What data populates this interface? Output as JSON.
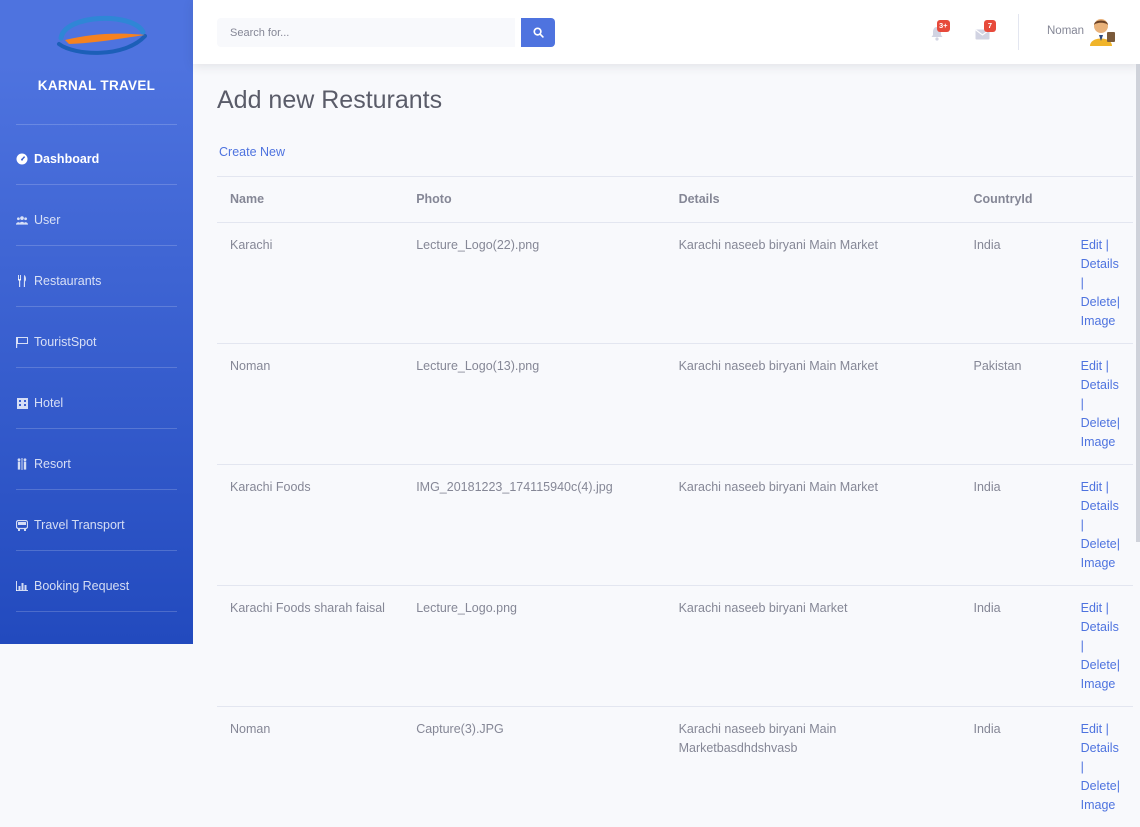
{
  "brand": {
    "name": "KARNAL TRAVEL"
  },
  "sidebar": {
    "items": [
      {
        "label": "Dashboard",
        "icon": "tachometer-icon",
        "active": true
      },
      {
        "label": "User",
        "icon": "users-icon"
      },
      {
        "label": "Restaurants",
        "icon": "utensils-icon"
      },
      {
        "label": "TouristSpot",
        "icon": "flag-icon"
      },
      {
        "label": "Hotel",
        "icon": "building-icon"
      },
      {
        "label": "Resort",
        "icon": "people-icon"
      },
      {
        "label": "Travel Transport",
        "icon": "bus-icon"
      },
      {
        "label": "Booking Request",
        "icon": "chart-icon"
      }
    ]
  },
  "topbar": {
    "search_placeholder": "Search for...",
    "alerts_count": "3+",
    "messages_count": "7",
    "user_name": "Noman"
  },
  "main": {
    "title": "Add new Resturants",
    "create_link": "Create New",
    "table": {
      "headers": [
        "Name",
        "Photo",
        "Details",
        "CountryId",
        ""
      ],
      "rows": [
        {
          "name": "Karachi",
          "photo": "Lecture_Logo(22).png",
          "details": "Karachi naseeb biryani Main Market",
          "country": "India"
        },
        {
          "name": "Noman",
          "photo": "Lecture_Logo(13).png",
          "details": "Karachi naseeb biryani Main Market",
          "country": "Pakistan"
        },
        {
          "name": "Karachi Foods",
          "photo": "IMG_20181223_174115940c(4).jpg",
          "details": "Karachi naseeb biryani Main Market",
          "country": "India"
        },
        {
          "name": "Karachi Foods sharah faisal",
          "photo": "Lecture_Logo.png",
          "details": "Karachi naseeb biryani Market",
          "country": "India"
        },
        {
          "name": "Noman",
          "photo": "Capture(3).JPG",
          "details": "Karachi naseeb biryani Main Marketbasdhdshvasb",
          "country": "India"
        }
      ],
      "actions": {
        "edit": "Edit",
        "details": "Details",
        "delete": "Delete",
        "image": "Image",
        "separator": " | ",
        "separator_last": "|"
      }
    }
  },
  "colors": {
    "primary": "#4e73df",
    "sidebar_bottom": "#224abe",
    "danger": "#e74a3b",
    "text": "#858796"
  }
}
